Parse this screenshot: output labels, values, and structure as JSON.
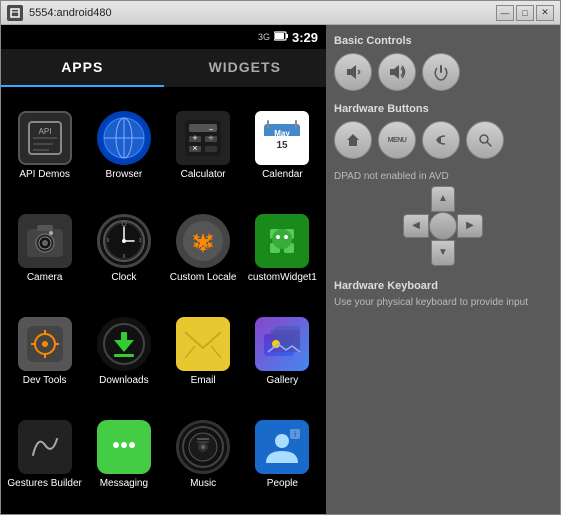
{
  "window": {
    "title": "5554:android480",
    "icon": "📱",
    "controls": {
      "minimize": "—",
      "maximize": "□",
      "close": "✕"
    }
  },
  "statusbar": {
    "signal": "3G",
    "battery": "🔋",
    "time": "3:29"
  },
  "tabs": {
    "apps_label": "APPS",
    "widgets_label": "WIDGETS"
  },
  "apps": [
    {
      "id": "api-demos",
      "label": "API Demos",
      "icon_type": "api"
    },
    {
      "id": "browser",
      "label": "Browser",
      "icon_type": "browser"
    },
    {
      "id": "calculator",
      "label": "Calculator",
      "icon_type": "calculator"
    },
    {
      "id": "calendar",
      "label": "Calendar",
      "icon_type": "calendar"
    },
    {
      "id": "camera",
      "label": "Camera",
      "icon_type": "camera"
    },
    {
      "id": "clock",
      "label": "Clock",
      "icon_type": "clock"
    },
    {
      "id": "custom-locale",
      "label": "Custom Locale",
      "icon_type": "custom-locale"
    },
    {
      "id": "custom-widget",
      "label": "customWidget1",
      "icon_type": "custom-widget"
    },
    {
      "id": "dev-tools",
      "label": "Dev Tools",
      "icon_type": "dev-tools"
    },
    {
      "id": "downloads",
      "label": "Downloads",
      "icon_type": "downloads"
    },
    {
      "id": "email",
      "label": "Email",
      "icon_type": "email"
    },
    {
      "id": "gallery",
      "label": "Gallery",
      "icon_type": "gallery"
    },
    {
      "id": "gestures",
      "label": "Gestures Builder",
      "icon_type": "gestures"
    },
    {
      "id": "messaging",
      "label": "Messaging",
      "icon_type": "messaging"
    },
    {
      "id": "music",
      "label": "Music",
      "icon_type": "music"
    },
    {
      "id": "people",
      "label": "People",
      "icon_type": "people"
    }
  ],
  "right_panel": {
    "basic_controls_title": "Basic Controls",
    "hardware_buttons_title": "Hardware Buttons",
    "dpad_label": "DPAD not enabled in AVD",
    "keyboard_title": "Hardware Keyboard",
    "keyboard_desc": "Use your physical keyboard to provide input",
    "buttons": {
      "volume_down": "🔈",
      "volume_up": "🔊",
      "power": "⏻",
      "home": "🏠",
      "menu": "MENU",
      "back": "↩",
      "search": "🔍"
    }
  }
}
